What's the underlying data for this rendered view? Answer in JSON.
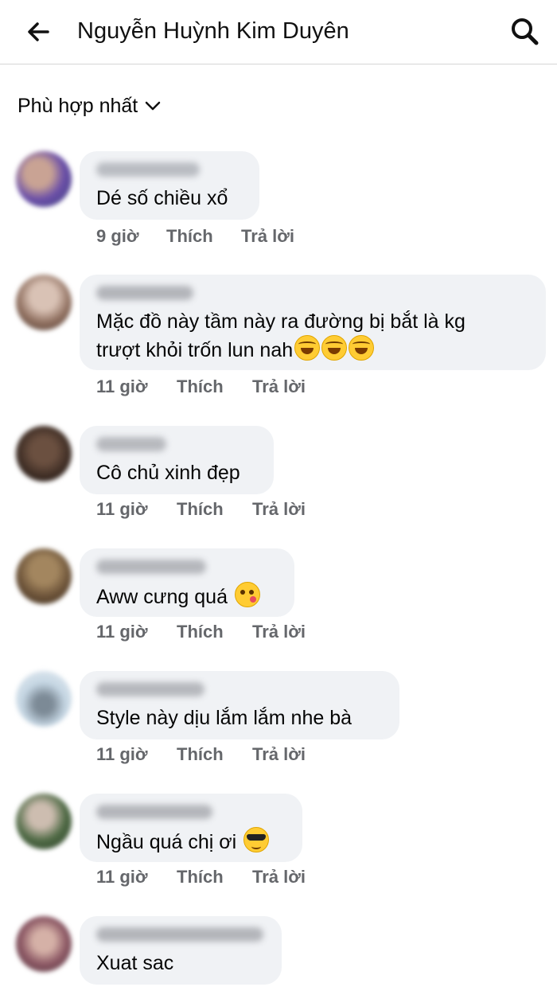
{
  "header": {
    "title": "Nguyễn Huỳnh Kim Duyên",
    "back_icon": "arrow-left-icon",
    "search_icon": "search-icon"
  },
  "sort": {
    "label": "Phù hợp nhất",
    "icon": "chevron-down-icon"
  },
  "actions": {
    "like": "Thích",
    "reply": "Trả lời"
  },
  "colors": {
    "bubble": "#f0f2f5",
    "meta": "#65676b"
  },
  "comments": [
    {
      "text": "Dé số chiều xổ",
      "time": "9 giờ",
      "emoji": []
    },
    {
      "text": "Mặc đồ này tầm này ra đường bị bắt là kg\ntrượt khỏi trốn lun nah",
      "time": "11 giờ",
      "emoji": [
        "rofl-emoji",
        "rofl-emoji",
        "rofl-emoji"
      ]
    },
    {
      "text": "Cô chủ xinh đẹp",
      "time": "11 giờ",
      "emoji": []
    },
    {
      "text": "Aww cưng quá",
      "time": "11 giờ",
      "emoji": [
        "kissing-emoji"
      ]
    },
    {
      "text": "Style này dịu lắm lắm nhe bà",
      "time": "11 giờ",
      "emoji": []
    },
    {
      "text": "Ngầu quá chị ơi",
      "time": "11 giờ",
      "emoji": [
        "sunglasses-emoji"
      ]
    },
    {
      "text": "Xuat sac",
      "time": "",
      "emoji": []
    }
  ]
}
